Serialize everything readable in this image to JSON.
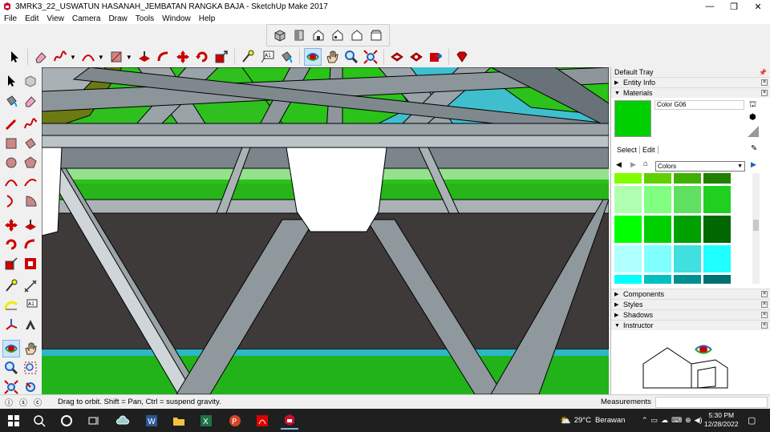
{
  "window": {
    "title": "3MRK3_22_USWATUN HASANAH_JEMBATAN RANGKA BAJA - SketchUp Make 2017",
    "minimize": "—",
    "maximize": "❐",
    "close": "✕"
  },
  "menu": [
    "File",
    "Edit",
    "View",
    "Camera",
    "Draw",
    "Tools",
    "Window",
    "Help"
  ],
  "tray": {
    "title": "Default Tray",
    "pin": "🖈",
    "entity_info": "Entity Info",
    "materials": "Materials",
    "material_name": "Color G06",
    "material_color": "#00d000",
    "select_tab": "Select",
    "edit_tab": "Edit",
    "library": "Colors",
    "components": "Components",
    "styles": "Styles",
    "shadows": "Shadows",
    "instructor": "Instructor",
    "swatches": [
      "#80ff00",
      "#60d000",
      "#40b000",
      "#208000",
      "#b0ffb0",
      "#80ff80",
      "#60e060",
      "#20d020",
      "#00ff00",
      "#00d000",
      "#00a000",
      "#006800",
      "#b0ffff",
      "#80ffff",
      "#40e0e0",
      "#20ffff",
      "#00ffff",
      "#00c0c0",
      "#009090",
      "#007070"
    ]
  },
  "status": {
    "message": "Drag to orbit. Shift = Pan, Ctrl = suspend gravity.",
    "measurements_label": "Measurements",
    "measurements_value": ""
  },
  "taskbar": {
    "temperature": "29°C",
    "weather": "Berawan",
    "time": "5:30 PM",
    "date": "12/28/2022"
  },
  "colors": {
    "accent": "#cde4f7",
    "sketchup_red": "#c8102e"
  }
}
